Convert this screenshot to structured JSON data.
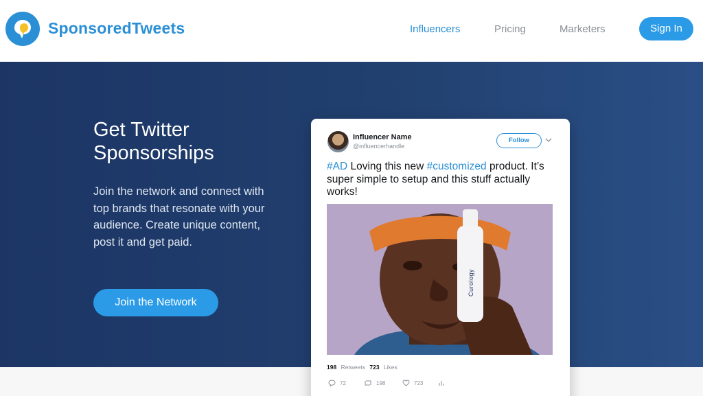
{
  "header": {
    "brand": "SponsoredTweets",
    "nav": [
      {
        "label": "Influencers",
        "active": true
      },
      {
        "label": "Pricing",
        "active": false
      },
      {
        "label": "Marketers",
        "active": false
      }
    ],
    "signin_label": "Sign In"
  },
  "hero": {
    "title": "Get Twitter Sponsorships",
    "description": "Join the network and connect with top brands that resonate with your audience. Create unique content, post it and get paid.",
    "cta_label": "Join the Network"
  },
  "tweet": {
    "name": "Influencer Name",
    "handle": "@influencerhandle",
    "follow_label": "Follow",
    "text_parts": {
      "tag1": "#AD",
      "mid": " Loving this new ",
      "tag2": "#customized",
      "rest": " product. It’s super simple to setup and this stuff actually works!"
    },
    "product_label": "Curology",
    "stats": {
      "retweets_count": "198",
      "retweets_label": "Retweets",
      "likes_count": "723",
      "likes_label": "Likes"
    },
    "actions": {
      "replies": "72",
      "retweets": "198",
      "likes": "723"
    }
  },
  "colors": {
    "brand_blue": "#2b8fd6",
    "button_blue": "#2b9be8",
    "hero_navy": "#1c3565"
  },
  "icons": [
    "logo-bubble-icon",
    "chevron-down-icon",
    "reply-icon",
    "retweet-icon",
    "heart-icon",
    "analytics-icon"
  ]
}
